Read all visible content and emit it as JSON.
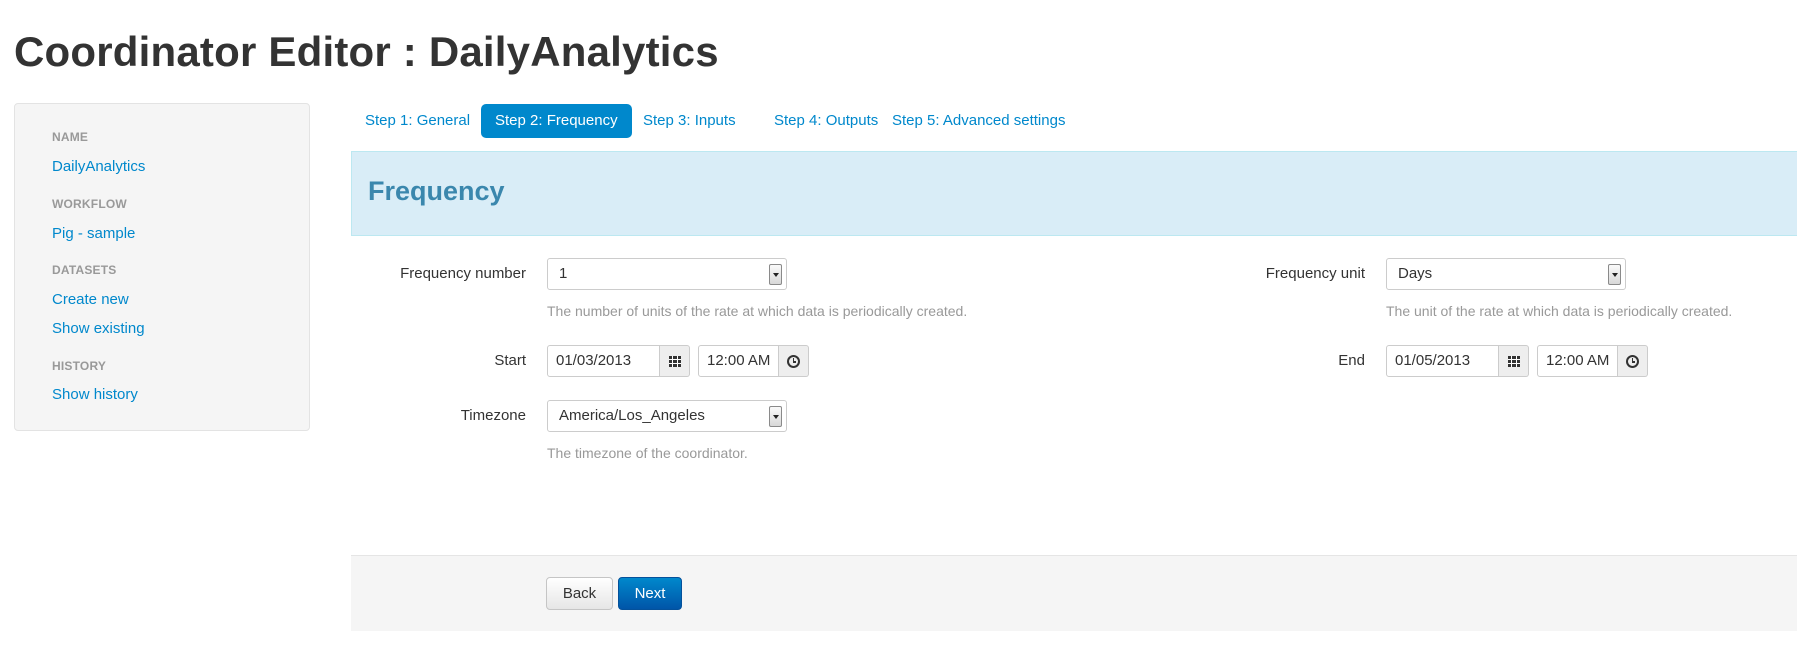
{
  "page": {
    "title": "Coordinator Editor : DailyAnalytics"
  },
  "sidebar": {
    "sections": [
      {
        "heading": "NAME",
        "links": [
          "DailyAnalytics"
        ]
      },
      {
        "heading": "WORKFLOW",
        "links": [
          "Pig - sample"
        ]
      },
      {
        "heading": "DATASETS",
        "links": [
          "Create new",
          "Show existing"
        ]
      },
      {
        "heading": "HISTORY",
        "links": [
          "Show history"
        ]
      }
    ]
  },
  "steps": [
    {
      "label": "Step 1: General",
      "active": false
    },
    {
      "label": "Step 2: Frequency",
      "active": true
    },
    {
      "label": "Step 3: Inputs",
      "active": false
    },
    {
      "label": "Step 4: Outputs",
      "active": false
    },
    {
      "label": "Step 5: Advanced settings",
      "active": false
    }
  ],
  "section": {
    "title": "Frequency"
  },
  "form": {
    "frequency_number": {
      "label": "Frequency number",
      "value": "1",
      "help": "The number of units of the rate at which data is periodically created."
    },
    "frequency_unit": {
      "label": "Frequency unit",
      "value": "Days",
      "help": "The unit of the rate at which data is periodically created."
    },
    "start": {
      "label": "Start",
      "date": "01/03/2013",
      "time": "12:00 AM"
    },
    "end": {
      "label": "End",
      "date": "01/05/2013",
      "time": "12:00 AM"
    },
    "timezone": {
      "label": "Timezone",
      "value": "America/Los_Angeles",
      "help": "The timezone of the coordinator."
    }
  },
  "actions": {
    "back": "Back",
    "next": "Next"
  },
  "colors": {
    "link": "#0088cc",
    "active_step_bg": "#0088cc",
    "banner_bg": "#d9edf7",
    "banner_text": "#3a87ad",
    "help_text": "#999999"
  },
  "icons": {
    "date_picker": "calendar-icon",
    "time_picker": "clock-icon",
    "select": "chevron-down-icon"
  }
}
